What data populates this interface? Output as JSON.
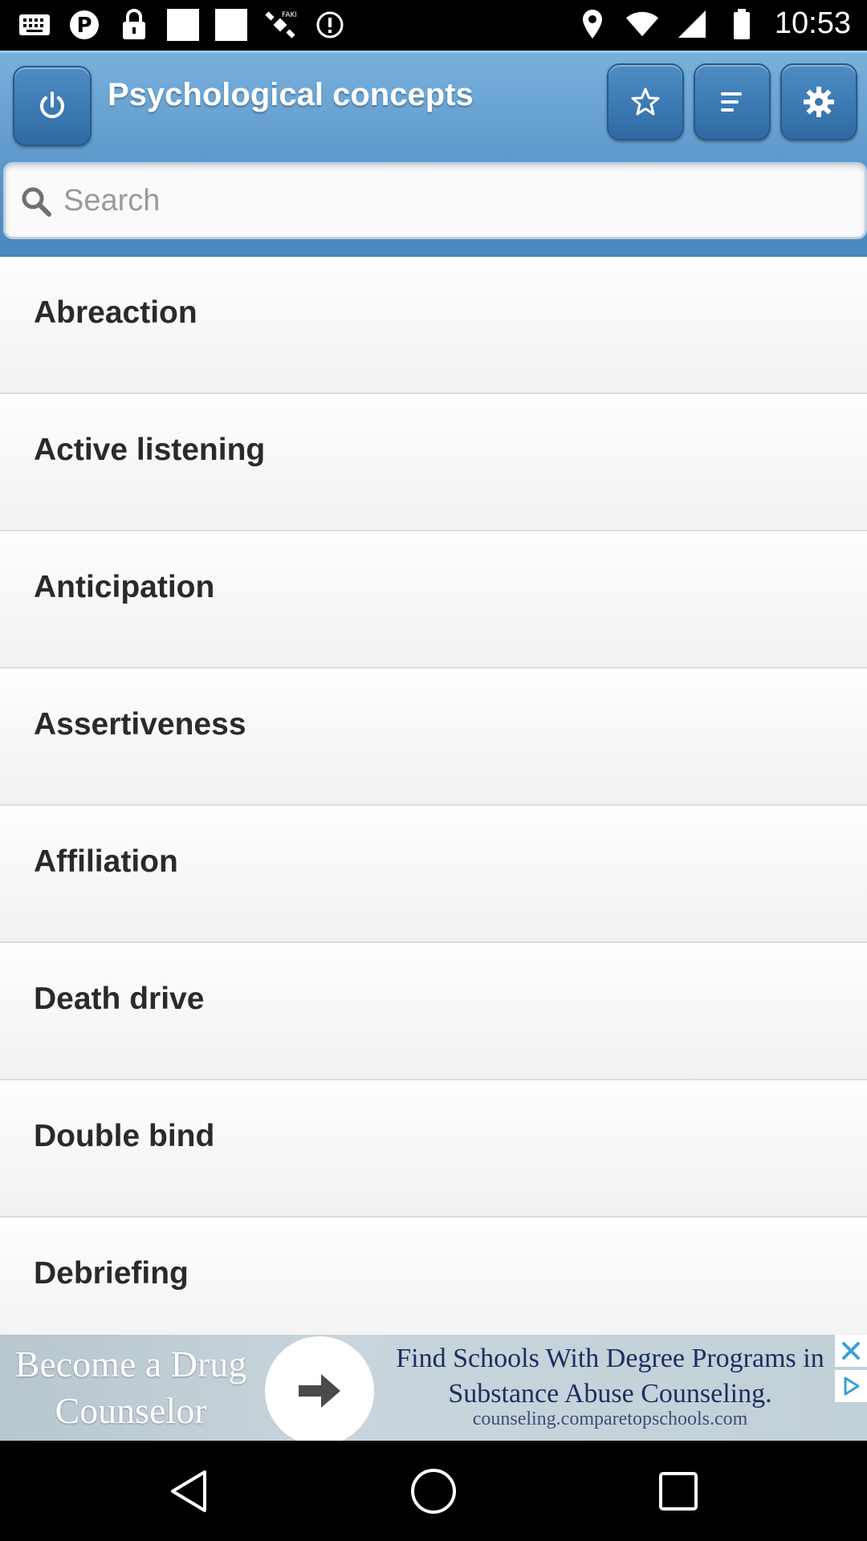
{
  "status_bar": {
    "time": "10:53",
    "left_icons": [
      "keyboard-icon",
      "pinterest-icon",
      "lock-icon",
      "square-icon",
      "square-icon",
      "satellite-icon",
      "alert-icon"
    ],
    "right_icons": [
      "location-icon",
      "wifi-icon",
      "signal-icon",
      "battery-icon"
    ]
  },
  "header": {
    "title": "Psychological concepts",
    "buttons": [
      "power-icon",
      "star-icon",
      "list-icon",
      "gear-icon"
    ]
  },
  "search": {
    "placeholder": "Search"
  },
  "list": {
    "items": [
      "Abreaction",
      "Active listening",
      "Anticipation",
      "Assertiveness",
      "Affiliation",
      "Death drive",
      "Double bind",
      "Debriefing"
    ]
  },
  "ad": {
    "left_text": "Become a Drug Counselor",
    "headline": "Find Schools With Degree Programs in Substance Abuse Counseling.",
    "domain": "counseling.comparetopschools.com"
  },
  "colors": {
    "header_blue": "#5c98cb",
    "button_blue": "#2f6aa5"
  }
}
